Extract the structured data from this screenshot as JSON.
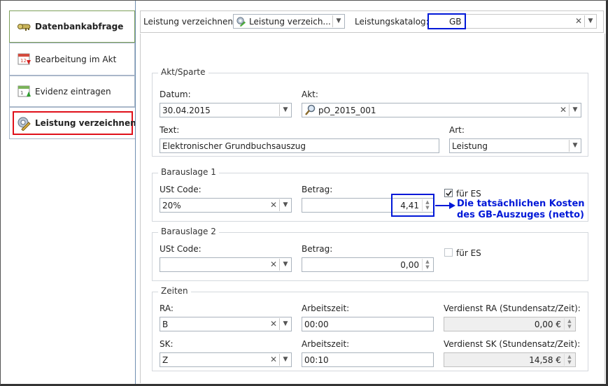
{
  "sidebar": {
    "items": [
      {
        "label": "Datenbankabfrage",
        "icon": "database-key-icon"
      },
      {
        "label": "Bearbeitung im Akt",
        "icon": "calendar-arrow-down-icon"
      },
      {
        "label": "Evidenz eintragen",
        "icon": "calendar-arrow-up-icon"
      },
      {
        "label": "Leistung verzeichnen",
        "icon": "gear-edit-icon"
      }
    ]
  },
  "toolbar": {
    "leistung_label": "Leistung verzeichnen:",
    "leistung_value": "Leistung verzeich...",
    "katalog_label": "Leistungskatalog:",
    "katalog_value": "GB"
  },
  "akt_sparte": {
    "caption": "Akt/Sparte",
    "datum_label": "Datum:",
    "datum_value": "30.04.2015",
    "akt_label": "Akt:",
    "akt_value": "pO_2015_001",
    "text_label": "Text:",
    "text_value": "Elektronischer Grundbuchsauszug",
    "art_label": "Art:",
    "art_value": "Leistung"
  },
  "barauslage1": {
    "caption": "Barauslage 1",
    "ust_label": "USt Code:",
    "ust_value": "20%",
    "betrag_label": "Betrag:",
    "betrag_value": "4,41",
    "es_label": "für ES",
    "es_checked": true
  },
  "annotation": {
    "line1": "Die tatsächlichen Kosten",
    "line2": "des GB-Auszuges (netto)",
    "color": "#0018d8"
  },
  "barauslage2": {
    "caption": "Barauslage 2",
    "ust_label": "USt Code:",
    "ust_value": "",
    "betrag_label": "Betrag:",
    "betrag_value": "0,00",
    "es_label": "für ES",
    "es_checked": false
  },
  "zeiten": {
    "caption": "Zeiten",
    "ra_label": "RA:",
    "ra_value": "B",
    "ra_zeit_label": "Arbeitszeit:",
    "ra_zeit_value": "00:00",
    "ra_verdienst_label": "Verdienst RA (Stundensatz/Zeit):",
    "ra_verdienst_value": "0,00 €",
    "sk_label": "SK:",
    "sk_value": "Z",
    "sk_zeit_label": "Arbeitszeit:",
    "sk_zeit_value": "00:10",
    "sk_verdienst_label": "Verdienst SK (Stundensatz/Zeit):",
    "sk_verdienst_value": "14,58 €"
  },
  "colors": {
    "highlight_blue": "#0018d8",
    "highlight_red": "#e0101a",
    "border": "#aab3bd"
  }
}
